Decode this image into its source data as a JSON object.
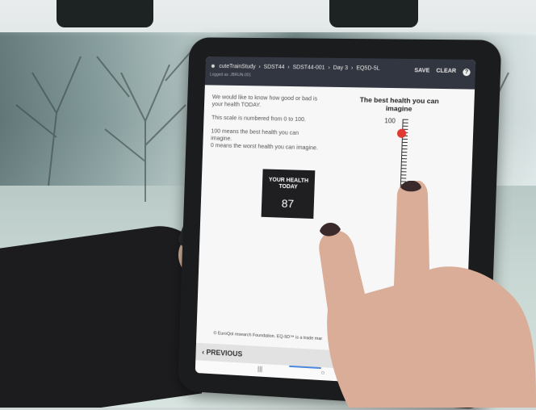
{
  "app": {
    "breadcrumbs": [
      "cuteTrainStudy",
      "SDST44",
      "SDST44-001",
      "Day 3",
      "EQ5D-5L"
    ],
    "breadcrumb_sub": "Logged as: JBRUN-001",
    "save_label": "SAVE",
    "clear_label": "CLEAR",
    "help_label": "?"
  },
  "instructions": {
    "line1": "We would like to know how good or bad is your health TODAY.",
    "line2": "This scale is numbered from 0 to 100.",
    "line3": "100 means the best health you can imagine.",
    "line4": "0 means the worst health you can imagine."
  },
  "scale": {
    "title": "The best health you can imagine",
    "top_value": "100",
    "selected_value": 87,
    "marker_color": "#e0392f"
  },
  "health": {
    "label": "YOUR HEALTH TODAY",
    "value": "87"
  },
  "footer": {
    "note": "© EuroQol research Foundation. EQ-5D™ is a trade mar"
  },
  "navigation": {
    "previous_label": "‹ PREVIOUS",
    "recent_icon": "|||",
    "home_icon": "○"
  },
  "colors": {
    "topbar": "#323640",
    "health_box": "#1f1f22",
    "accent": "#4a89dc"
  }
}
